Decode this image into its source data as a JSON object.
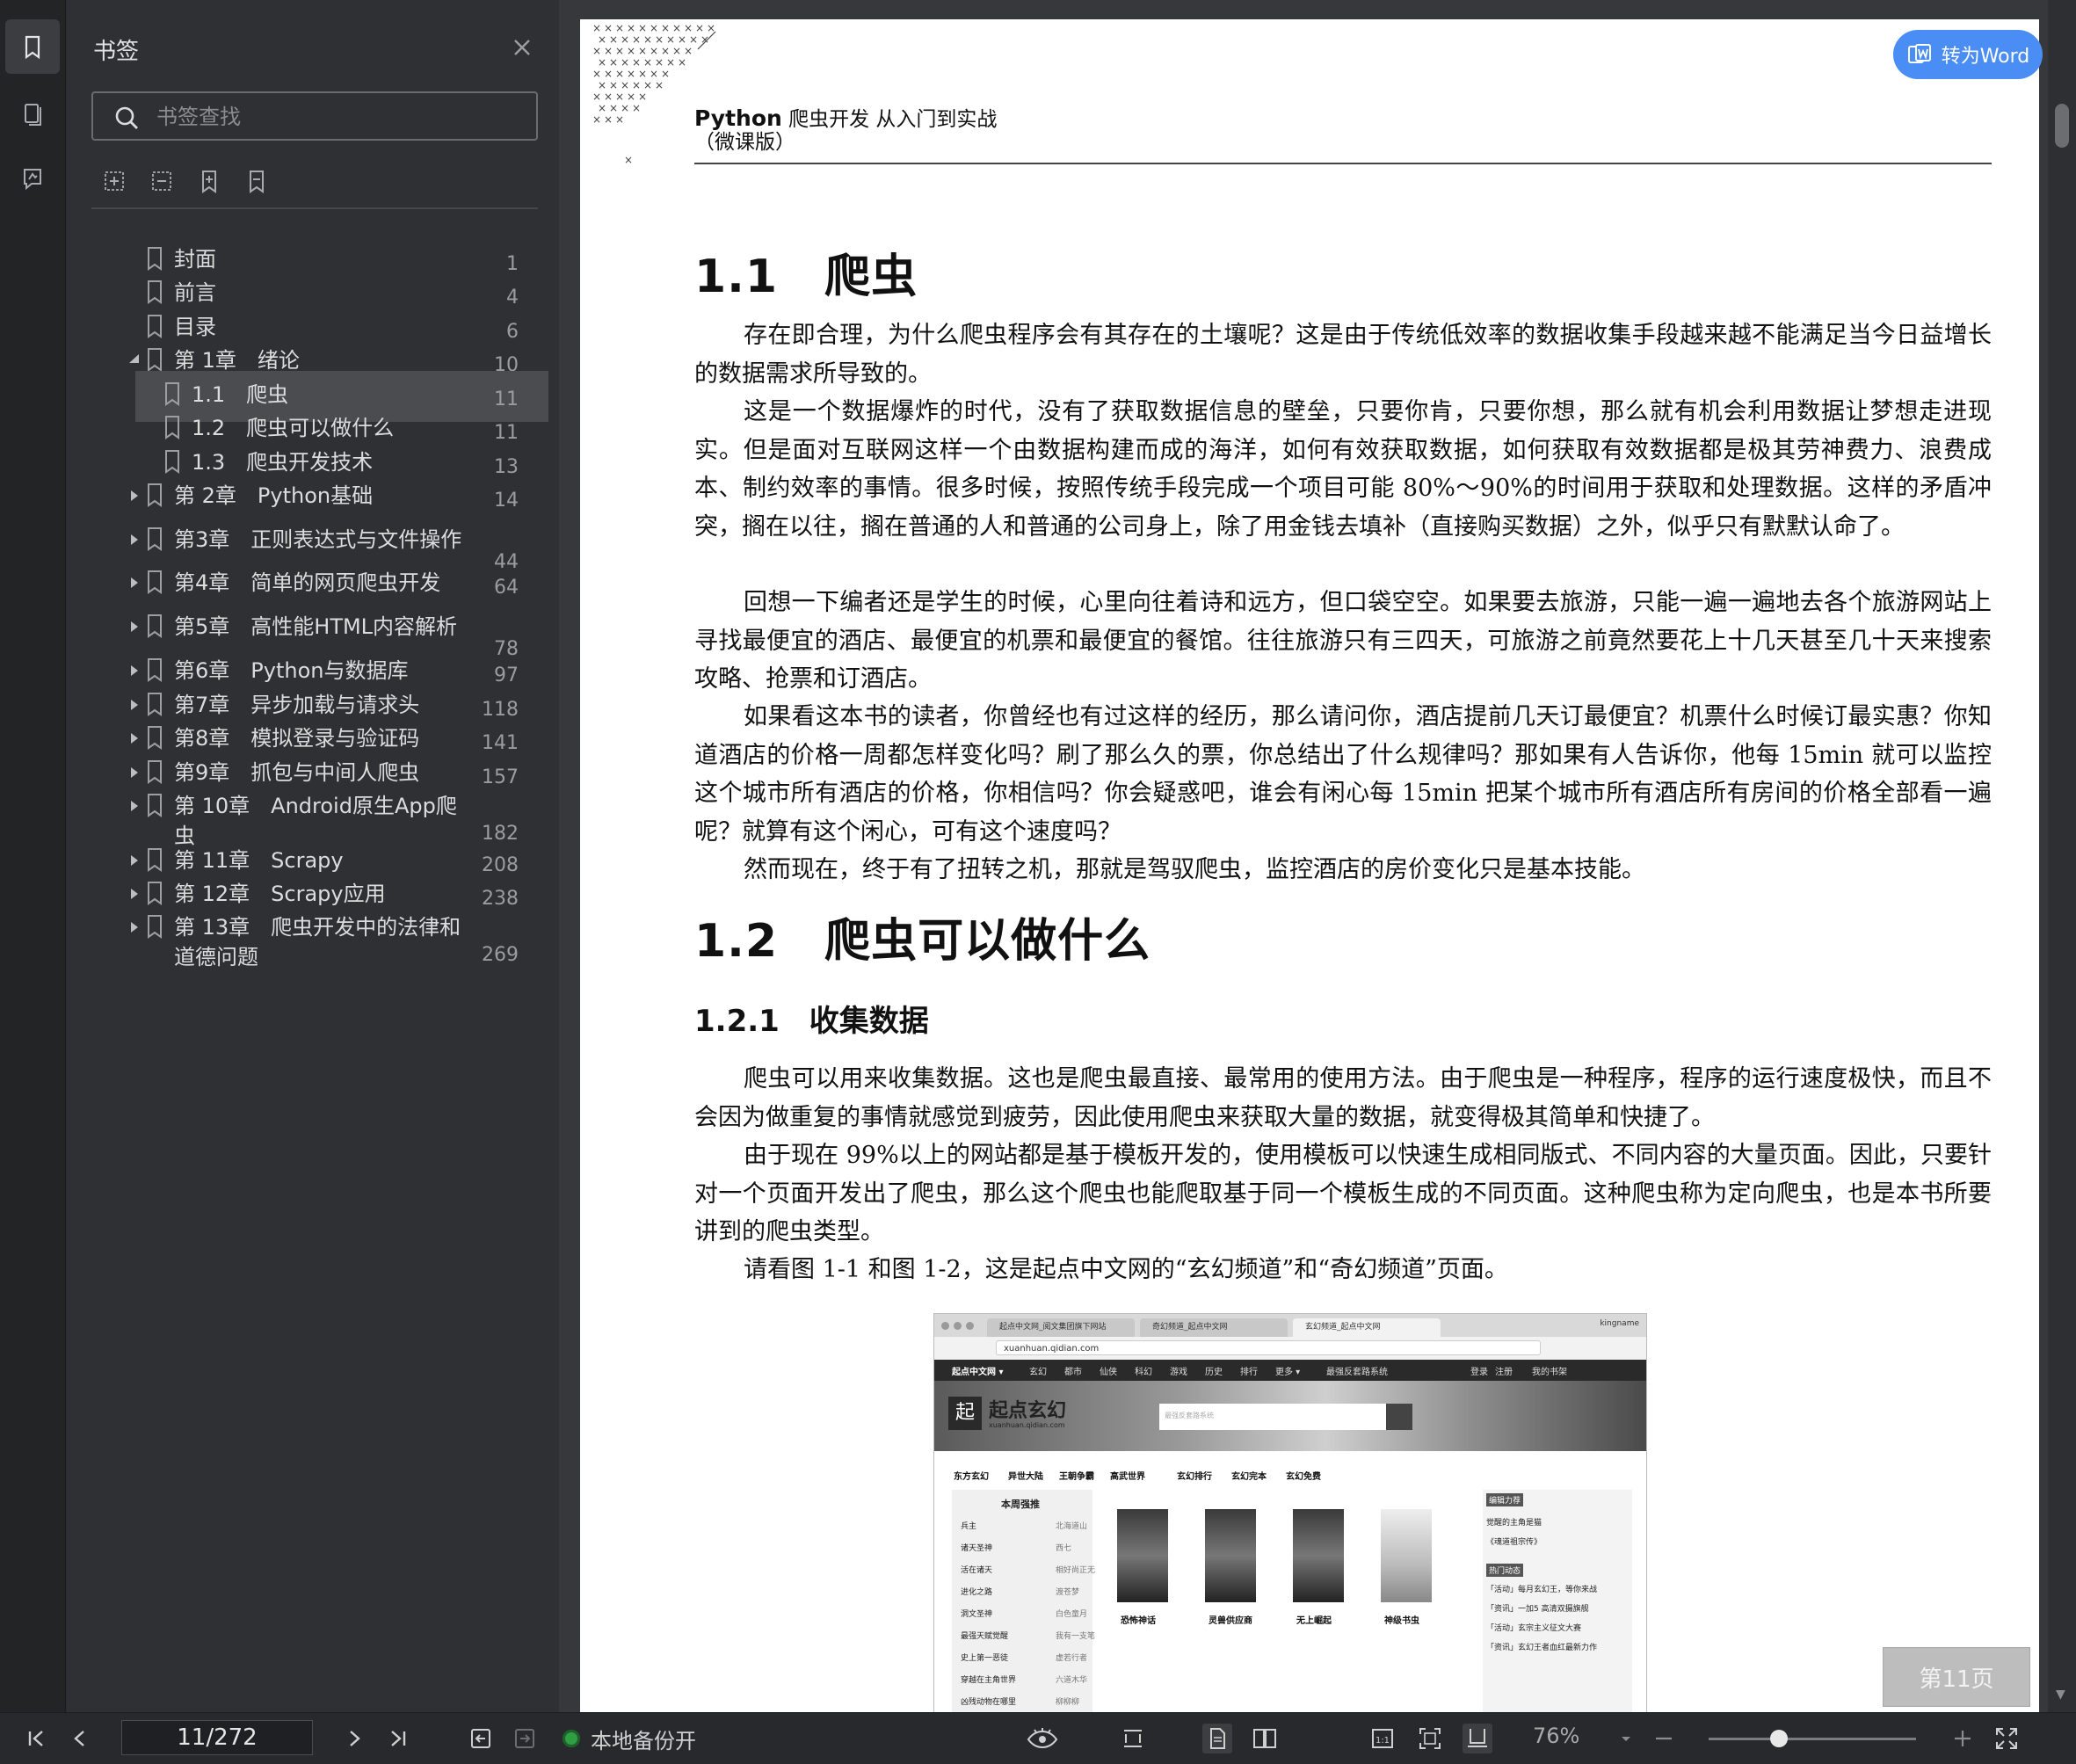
{
  "sidebar_rail": {
    "items": [
      {
        "name": "bookmark-tab-icon",
        "active": true
      },
      {
        "name": "thumbnail-tab-icon",
        "active": false
      },
      {
        "name": "annotation-tab-icon",
        "active": false
      }
    ]
  },
  "panel": {
    "title": "书签",
    "search_placeholder": "书签查找"
  },
  "bookmarks": [
    {
      "label": "封面",
      "page": "1",
      "level": 0,
      "expand": "none"
    },
    {
      "label": "前言",
      "page": "4",
      "level": 0,
      "expand": "none"
    },
    {
      "label": "目录",
      "page": "6",
      "level": 0,
      "expand": "none"
    },
    {
      "label": "第 1章　绪论",
      "page": "10",
      "level": 0,
      "expand": "open"
    },
    {
      "label": "1.1　爬虫",
      "page": "11",
      "level": 1,
      "expand": "none",
      "selected": true
    },
    {
      "label": "1.2　爬虫可以做什么",
      "page": "11",
      "level": 1,
      "expand": "none"
    },
    {
      "label": "1.3　爬虫开发技术",
      "page": "13",
      "level": 1,
      "expand": "none"
    },
    {
      "label": "第 2章　Python基础",
      "page": "14",
      "level": 0,
      "expand": "closed"
    },
    {
      "label": "第3章　正则表达式与文件操作",
      "page": "44",
      "level": 0,
      "expand": "closed"
    },
    {
      "label": "第4章　简单的网页爬虫开发",
      "page": "64",
      "level": 0,
      "expand": "closed"
    },
    {
      "label": "第5章　高性能HTML内容解析",
      "page": "78",
      "level": 0,
      "expand": "closed"
    },
    {
      "label": "第6章　Python与数据库",
      "page": "97",
      "level": 0,
      "expand": "closed"
    },
    {
      "label": "第7章　异步加载与请求头",
      "page": "118",
      "level": 0,
      "expand": "closed"
    },
    {
      "label": "第8章　模拟登录与验证码",
      "page": "141",
      "level": 0,
      "expand": "closed"
    },
    {
      "label": "第9章　抓包与中间人爬虫",
      "page": "157",
      "level": 0,
      "expand": "closed"
    },
    {
      "label": "第 10章　Android原生App爬",
      "label2": "虫",
      "page": "182",
      "level": 0,
      "expand": "closed"
    },
    {
      "label": "第 11章　Scrapy",
      "page": "208",
      "level": 0,
      "expand": "closed"
    },
    {
      "label": "第 12章　Scrapy应用",
      "page": "238",
      "level": 0,
      "expand": "closed"
    },
    {
      "label": "第 13章　爬虫开发中的法律和",
      "label2": "道德问题",
      "page": "269",
      "level": 0,
      "expand": "closed"
    }
  ],
  "document": {
    "header": {
      "brand": "Python",
      "title": "爬虫开发  从入门到实战",
      "subtitle": "（微课版）"
    },
    "sections": {
      "h1_1": "1.1　爬虫",
      "h1_2": "1.2　爬虫可以做什么",
      "h2_1": "1.2.1　收集数据"
    },
    "paragraphs": [
      "存在即合理，为什么爬虫程序会有其存在的土壤呢？这是由于传统低效率的数据收集手段越来越不能满足当今日益增长的数据需求所导致的。",
      "这是一个数据爆炸的时代，没有了获取数据信息的壁垒，只要你肯，只要你想，那么就有机会利用数据让梦想走进现实。但是面对互联网这样一个由数据构建而成的海洋，如何有效获取数据，如何获取有效数据都是极其劳神费力、浪费成本、制约效率的事情。很多时候，按照传统手段完成一个项目可能 80%～90%的时间用于获取和处理数据。这样的矛盾冲突，搁在以往，搁在普通的人和普通的公司身上，除了用金钱去填补（直接购买数据）之外，似乎只有默默认命了。",
      "回想一下编者还是学生的时候，心里向往着诗和远方，但口袋空空。如果要去旅游，只能一遍一遍地去各个旅游网站上寻找最便宜的酒店、最便宜的机票和最便宜的餐馆。往往旅游只有三四天，可旅游之前竟然要花上十几天甚至几十天来搜索攻略、抢票和订酒店。",
      "如果看这本书的读者，你曾经也有过这样的经历，那么请问你，酒店提前几天订最便宜？机票什么时候订最实惠？你知道酒店的价格一周都怎样变化吗？刷了那么久的票，你总结出了什么规律吗？那如果有人告诉你，他每 15min 就可以监控这个城市所有酒店的价格，你相信吗？你会疑惑吧，谁会有闲心每 15min 把某个城市所有酒店所有房间的价格全部看一遍呢？就算有这个闲心，可有这个速度吗？",
      "然而现在，终于有了扭转之机，那就是驾驭爬虫，监控酒店的房价变化只是基本技能。",
      "爬虫可以用来收集数据。这也是爬虫最直接、最常用的使用方法。由于爬虫是一种程序，程序的运行速度极快，而且不会因为做重复的事情就感觉到疲劳，因此使用爬虫来获取大量的数据，就变得极其简单和快捷了。",
      "由于现在 99%以上的网站都是基于模板开发的，使用模板可以快速生成相同版式、不同内容的大量页面。因此，只要针对一个页面开发出了爬虫，那么这个爬虫也能爬取基于同一个模板生成的不同页面。这种爬虫称为定向爬虫，也是本书所要讲到的爬虫类型。",
      "请看图 1-1 和图 1-2，这是起点中文网的“玄幻频道”和“奇幻频道”页面。"
    ],
    "figure": {
      "tabs": [
        "起点中文网_阅文集团旗下网站",
        "奇幻频道_起点中文网",
        "玄幻频道_起点中文网"
      ],
      "profile": "kingname",
      "url": "xuanhuan.qidian.com",
      "nav": [
        "起点中文网 ▾",
        "玄幻",
        "都市",
        "仙侠",
        "科幻",
        "游戏",
        "历史",
        "排行",
        "更多 ▾",
        "最强反套路系统",
        "登录",
        "注册",
        "我的书架"
      ],
      "logo_char": "起",
      "logo_text": "起点玄幻",
      "logo_sub": "xuanhuan.qidian.com",
      "search_placeholder": "最强反套路系统",
      "categories": [
        "东方玄幻",
        "异世大陆",
        "王朝争霸",
        "高武世界",
        "玄幻排行",
        "玄幻完本",
        "玄幻免费"
      ],
      "weekly_title": "本周强推",
      "weekly": [
        {
          "title": "兵主",
          "author": "北海道山"
        },
        {
          "title": "诸天圣神",
          "author": "西七"
        },
        {
          "title": "活在诸天",
          "author": "相好尚正无"
        },
        {
          "title": "进化之路",
          "author": "渡苍梦"
        },
        {
          "title": "洞文圣神",
          "author": "白色童月"
        },
        {
          "title": "最强天赋觉醒",
          "author": "我有一支笔"
        },
        {
          "title": "史上第一恶徒",
          "author": "虚若行者"
        },
        {
          "title": "穿越在主角世界",
          "author": "六道木华"
        },
        {
          "title": "凶残动物在哪里",
          "author": "柳柳柳"
        }
      ],
      "covers": [
        "恐怖神话",
        "灵兽供应商",
        "无上崛起",
        "神级书虫"
      ],
      "right_tags": [
        "编辑力荐",
        "热门动态"
      ],
      "right_items": [
        "觉醒的主角是猫",
        "《魂道祖宗传》",
        "「活动」每月玄幻王，等你来战",
        "「资讯」一加5 高清双摄旗舰",
        "「活动」玄宗主义征文大赛",
        "「资讯」玄幻王者血红最新力作"
      ]
    },
    "page_badge": "第11页"
  },
  "convert_button": "转为Word",
  "bottombar": {
    "page_display": "11/272",
    "backup_status": "本地备份开",
    "zoom": "76%",
    "zoom_fraction": 0.34
  }
}
